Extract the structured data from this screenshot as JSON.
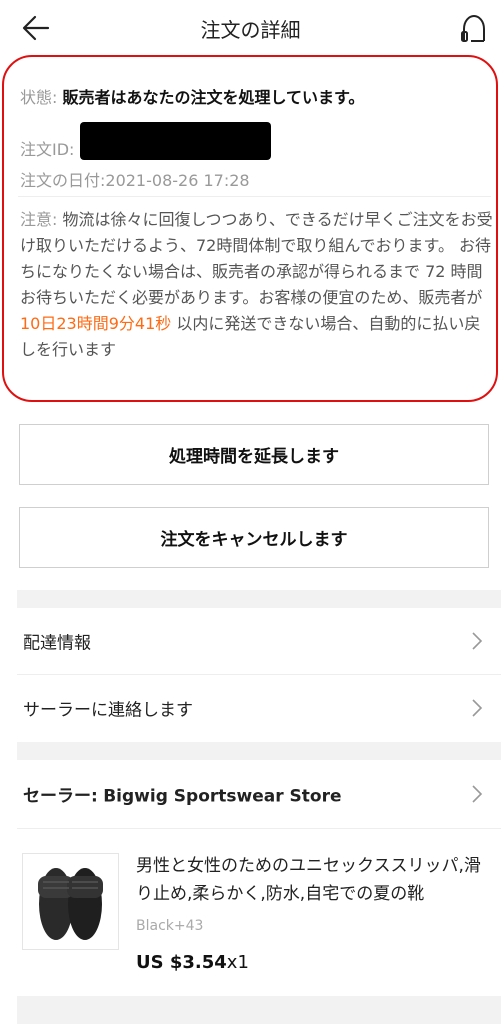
{
  "header": {
    "title": "注文の詳細",
    "back_icon": "arrow-left-icon",
    "support_icon": "headset-icon"
  },
  "order": {
    "status_label": "状態:",
    "status_value": "販売者はあなたの注文を処理しています。",
    "id_label": "注文ID:",
    "date_text": "注文の日付:2021-08-26 17:28",
    "notice_label": "注意:",
    "notice_text_1": "物流は徐々に回復しつつあり、できるだけ早くご注文をお受け取りいただけるよう、72時間体制で取り組んでおります。 お待ちになりたくない場合は、販売者の承認が得られるまで 72 時間お待ちいただく必要があります。お客様の便宜のため、販売者が",
    "notice_countdown": "10日23時間9分41秒",
    "notice_text_2": "以内に発送できない場合、自動的に払い戻しを行います",
    "highlight_color": "#ff6a13",
    "annotation_color": "#e01010"
  },
  "actions": {
    "extend_label": "処理時間を延長します",
    "cancel_label": "注文をキャンセルします"
  },
  "menu": {
    "shipping_label": "配達情報",
    "contact_label": "サーラーに連絡します"
  },
  "seller": {
    "label": "セーラー:",
    "name": "Bigwig Sportswear Store"
  },
  "product": {
    "title": "男性と女性のためのユニセックススリッパ,滑り止め,柔らかく,防水,自宅での夏の靴",
    "variant": "Black+43",
    "price": "US $3.54",
    "quantity": "x1"
  }
}
